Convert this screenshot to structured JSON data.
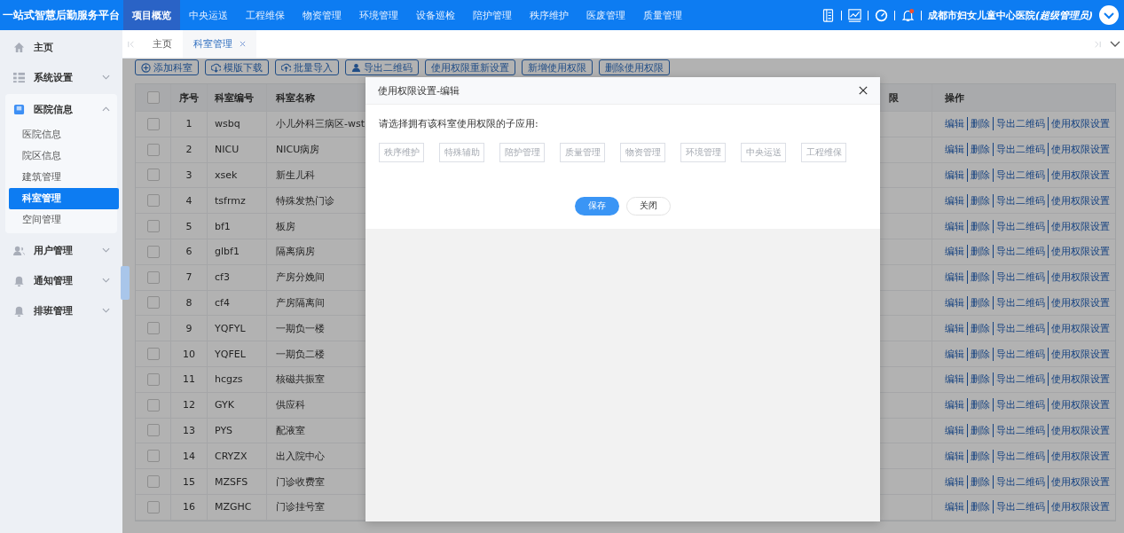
{
  "app_title": "一站式智慧后勤服务平台",
  "nav": [
    {
      "label": "项目概览",
      "selected": true
    },
    {
      "label": "中央运送",
      "selected": false
    },
    {
      "label": "工程维保",
      "selected": false
    },
    {
      "label": "物资管理",
      "selected": false
    },
    {
      "label": "环境管理",
      "selected": false
    },
    {
      "label": "设备巡检",
      "selected": false
    },
    {
      "label": "陪护管理",
      "selected": false
    },
    {
      "label": "秩序维护",
      "selected": false
    },
    {
      "label": "医废管理",
      "selected": false
    },
    {
      "label": "质量管理",
      "selected": false
    }
  ],
  "notifications_unread": true,
  "user": {
    "name": "成都市妇女儿童中心医院",
    "role": "(超级管理员)"
  },
  "sidebar": {
    "items": [
      {
        "label": "主页",
        "kind": "home",
        "expanded": false
      },
      {
        "label": "系统设置",
        "kind": "grid",
        "expanded": false
      },
      {
        "label": "医院信息",
        "kind": "book",
        "expanded": true,
        "children": [
          {
            "label": "医院信息",
            "selected": false
          },
          {
            "label": "院区信息",
            "selected": false
          },
          {
            "label": "建筑管理",
            "selected": false
          },
          {
            "label": "科室管理",
            "selected": true
          },
          {
            "label": "空间管理",
            "selected": false
          }
        ]
      },
      {
        "label": "用户管理",
        "kind": "user",
        "expanded": false
      },
      {
        "label": "通知管理",
        "kind": "bell",
        "expanded": false
      },
      {
        "label": "排班管理",
        "kind": "bell",
        "expanded": false
      }
    ]
  },
  "tabs": [
    {
      "label": "主页",
      "selected": false,
      "closable": false
    },
    {
      "label": "科室管理",
      "selected": true,
      "closable": true
    }
  ],
  "toolbar": [
    {
      "label": "添加科室",
      "kind": "add"
    },
    {
      "label": "模版下载",
      "kind": "download"
    },
    {
      "label": "批量导入",
      "kind": "upload"
    },
    {
      "label": "导出二维码",
      "kind": "export"
    },
    {
      "label": "使用权限重新设置",
      "kind": "plain"
    },
    {
      "label": "新增使用权限",
      "kind": "plain"
    },
    {
      "label": "删除使用权限",
      "kind": "plain"
    }
  ],
  "table": {
    "select_all_checked": false,
    "columns": [
      "序号",
      "科室编号",
      "科室名称",
      "限",
      "操作"
    ],
    "rows": [
      {
        "checked": false,
        "index": "1",
        "code": "wsbq",
        "name": "小儿外科三病区-wst",
        "actions": [
          "编辑",
          "删除",
          "导出二维码",
          "使用权限设置"
        ]
      },
      {
        "checked": false,
        "index": "2",
        "code": "NICU",
        "name": "NICU病房",
        "actions": [
          "编辑",
          "删除",
          "导出二维码",
          "使用权限设置"
        ]
      },
      {
        "checked": false,
        "index": "3",
        "code": "xsek",
        "name": "新生儿科",
        "actions": [
          "编辑",
          "删除",
          "导出二维码",
          "使用权限设置"
        ]
      },
      {
        "checked": false,
        "index": "4",
        "code": "tsfrmz",
        "name": "特殊发热门诊",
        "actions": [
          "编辑",
          "删除",
          "导出二维码",
          "使用权限设置"
        ]
      },
      {
        "checked": false,
        "index": "5",
        "code": "bf1",
        "name": "板房",
        "actions": [
          "编辑",
          "删除",
          "导出二维码",
          "使用权限设置"
        ]
      },
      {
        "checked": false,
        "index": "6",
        "code": "glbf1",
        "name": "隔离病房",
        "actions": [
          "编辑",
          "删除",
          "导出二维码",
          "使用权限设置"
        ]
      },
      {
        "checked": false,
        "index": "7",
        "code": "cf3",
        "name": "产房分娩间",
        "actions": [
          "编辑",
          "删除",
          "导出二维码",
          "使用权限设置"
        ]
      },
      {
        "checked": false,
        "index": "8",
        "code": "cf4",
        "name": "产房隔离间",
        "actions": [
          "编辑",
          "删除",
          "导出二维码",
          "使用权限设置"
        ]
      },
      {
        "checked": false,
        "index": "9",
        "code": "YQFYL",
        "name": "一期负一楼",
        "actions": [
          "编辑",
          "删除",
          "导出二维码",
          "使用权限设置"
        ]
      },
      {
        "checked": false,
        "index": "10",
        "code": "YQFEL",
        "name": "一期负二楼",
        "actions": [
          "编辑",
          "删除",
          "导出二维码",
          "使用权限设置"
        ]
      },
      {
        "checked": false,
        "index": "11",
        "code": "hcgzs",
        "name": "核磁共振室",
        "actions": [
          "编辑",
          "删除",
          "导出二维码",
          "使用权限设置"
        ]
      },
      {
        "checked": false,
        "index": "12",
        "code": "GYK",
        "name": "供应科",
        "actions": [
          "编辑",
          "删除",
          "导出二维码",
          "使用权限设置"
        ]
      },
      {
        "checked": false,
        "index": "13",
        "code": "PYS",
        "name": "配液室",
        "actions": [
          "编辑",
          "删除",
          "导出二维码",
          "使用权限设置"
        ]
      },
      {
        "checked": false,
        "index": "14",
        "code": "CRYZX",
        "name": "出入院中心",
        "actions": [
          "编辑",
          "删除",
          "导出二维码",
          "使用权限设置"
        ]
      },
      {
        "checked": false,
        "index": "15",
        "code": "MZSFS",
        "name": "门诊收费室",
        "actions": [
          "编辑",
          "删除",
          "导出二维码",
          "使用权限设置"
        ]
      },
      {
        "checked": false,
        "index": "16",
        "code": "MZGHC",
        "name": "门诊挂号室",
        "actions": [
          "编辑",
          "删除",
          "导出二维码",
          "使用权限设置"
        ]
      }
    ]
  },
  "dialog": {
    "title": "使用权限设置-编辑",
    "prompt": "请选择拥有该科室使用权限的子应用:",
    "options": [
      {
        "label": "秩序维护",
        "selected": false
      },
      {
        "label": "特殊辅助",
        "selected": false
      },
      {
        "label": "陪护管理",
        "selected": false
      },
      {
        "label": "质量管理",
        "selected": false
      },
      {
        "label": "物资管理",
        "selected": false
      },
      {
        "label": "环境管理",
        "selected": false
      },
      {
        "label": "中央运送",
        "selected": false
      },
      {
        "label": "工程维保",
        "selected": false
      }
    ],
    "buttons": [
      {
        "label": "保存",
        "kind": "primary"
      },
      {
        "label": "关闭",
        "kind": "default"
      }
    ]
  }
}
